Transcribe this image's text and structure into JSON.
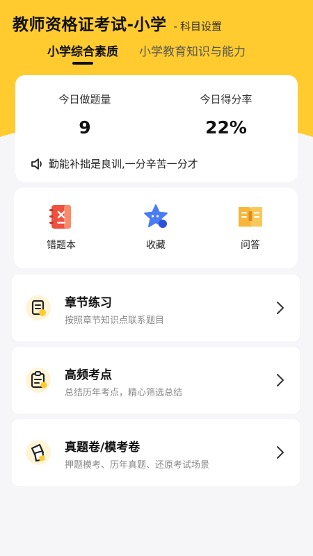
{
  "header": {
    "title": "教师资格证考试-小学",
    "separator": "-",
    "setting_label": "科目设置"
  },
  "tabs": [
    {
      "label": "小学综合素质",
      "active": true
    },
    {
      "label": "小学教育知识与能力",
      "active": false
    }
  ],
  "stats": {
    "today_count_label": "今日做题量",
    "today_count_value": "9",
    "score_rate_label": "今日得分率",
    "score_rate_value": "22%",
    "motto": "勤能补拙是良训,一分辛苦一分才"
  },
  "quick_actions": [
    {
      "label": "错题本",
      "icon": "wrong-book-icon"
    },
    {
      "label": "收藏",
      "icon": "star-icon"
    },
    {
      "label": "问答",
      "icon": "qa-book-icon"
    }
  ],
  "menu": [
    {
      "title": "章节练习",
      "subtitle": "按照章节知识点联系题目",
      "icon": "document-icon"
    },
    {
      "title": "高频考点",
      "subtitle": "总结历年考点，精心筛选总结",
      "icon": "clipboard-icon"
    },
    {
      "title": "真题卷/模考卷",
      "subtitle": "押题模考、历年真题、还原考试场景",
      "icon": "papers-icon"
    }
  ],
  "colors": {
    "brand_yellow": "#ffcb2f",
    "wrong_book_red": "#f0513f",
    "star_blue": "#4a7cf5",
    "qa_orange": "#f6b63a"
  }
}
